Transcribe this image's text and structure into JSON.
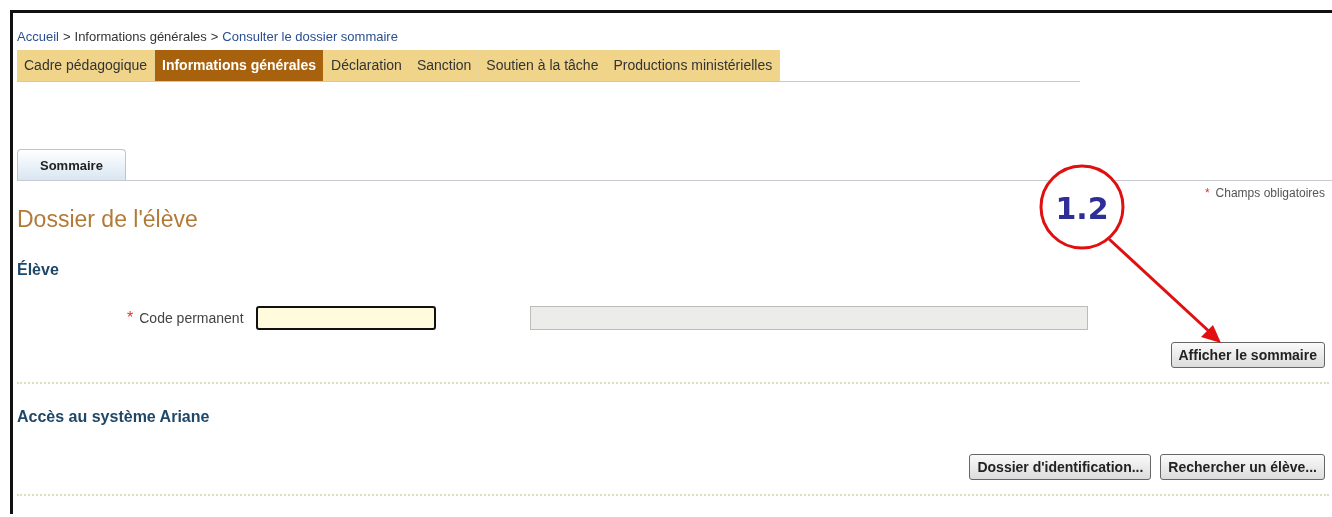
{
  "breadcrumb": [
    {
      "label": "Accueil",
      "kind": "link"
    },
    {
      "label": ">",
      "kind": "separator"
    },
    {
      "label": "Informations générales",
      "kind": "text"
    },
    {
      "label": ">",
      "kind": "separator"
    },
    {
      "label": "Consulter le dossier sommaire",
      "kind": "link"
    }
  ],
  "tabs": [
    {
      "label": "Cadre pédagogique",
      "selected": false
    },
    {
      "label": "Informations générales",
      "selected": true
    },
    {
      "label": "Déclaration",
      "selected": false
    },
    {
      "label": "Sanction",
      "selected": false
    },
    {
      "label": "Soutien à la tâche",
      "selected": false
    },
    {
      "label": "Productions ministérielles",
      "selected": false
    }
  ],
  "subtabs": [
    {
      "label": "Sommaire",
      "selected": true
    }
  ],
  "required_note": {
    "mark": "*",
    "text": "Champs obligatoires"
  },
  "title": "Dossier de l'élève",
  "sections": [
    {
      "heading": "Élève",
      "fields": [
        {
          "mark": "*",
          "label": "Code permanent"
        }
      ],
      "buttons": [
        "Afficher le sommaire"
      ]
    },
    {
      "heading": "Accès au système Ariane",
      "buttons": [
        "Dossier d'identification...",
        "Rechercher un élève..."
      ]
    }
  ],
  "annotation": {
    "label": "1.2"
  }
}
